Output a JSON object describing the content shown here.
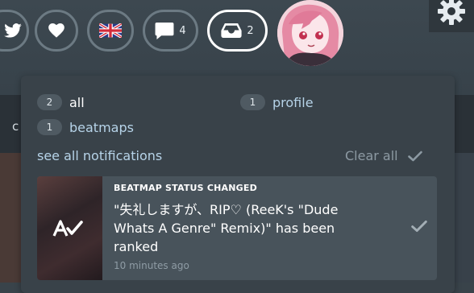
{
  "colors": {
    "accent_text": "#b6d3e8",
    "panel": "#394249",
    "card": "#48535b"
  },
  "header": {
    "buttons": [
      {
        "name": "twitter-button",
        "icon": "twitter-bird-icon"
      },
      {
        "name": "support-button",
        "icon": "heart-icon"
      },
      {
        "name": "language-button",
        "icon": "uk-flag-icon"
      },
      {
        "name": "chat-button",
        "icon": "chat-bubble-icon",
        "count": "4"
      },
      {
        "name": "notifications-button",
        "icon": "inbox-tray-icon",
        "count": "2"
      }
    ],
    "settings_icon": "gear-icon",
    "avatar": "user-avatar"
  },
  "notifications": {
    "filters": [
      {
        "count": "2",
        "label": "all"
      },
      {
        "count": "1",
        "label": "profile"
      },
      {
        "count": "1",
        "label": "beatmaps"
      }
    ],
    "see_all": "see all notifications",
    "clear_all": "Clear all",
    "items": [
      {
        "type": "BEATMAP STATUS CHANGED",
        "title": "\"失礼しますが、RIP♡ (ReeK's \"Dude Whats A Genre\" Remix)\" has been ranked",
        "time": "10 minutes ago"
      }
    ]
  },
  "background": {
    "partial_letter": "c"
  }
}
